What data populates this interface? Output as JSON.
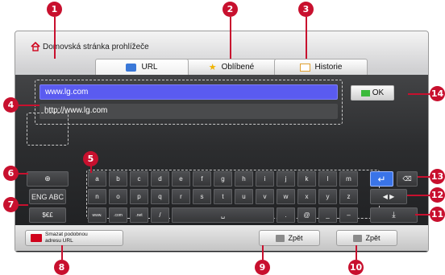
{
  "header": {
    "title": "Domovská stránka prohlížeče"
  },
  "tabs": [
    {
      "label": "URL"
    },
    {
      "label": "Oblíbené"
    },
    {
      "label": "Historie"
    }
  ],
  "url_panel": {
    "rows": [
      "www.lg.com",
      "http://www.lg.com"
    ]
  },
  "ok_label": "OK",
  "keyboard": {
    "row1": [
      "a",
      "b",
      "c",
      "d",
      "e",
      "f",
      "g",
      "h",
      "i",
      "j",
      "k",
      "l",
      "m"
    ],
    "row2": [
      "n",
      "o",
      "p",
      "q",
      "r",
      "s",
      "t",
      "u",
      "v",
      "w",
      "x",
      "y",
      "z"
    ],
    "row3": [
      "www.",
      ".com",
      ".net",
      "/",
      "␣",
      ".",
      "@",
      "_",
      "–"
    ]
  },
  "side_keys": {
    "globe": "⊕",
    "lang": "ENG ABC",
    "symbols": "$€£",
    "enter": "↵",
    "backspace": "⌫",
    "arrows": "◀ ▶",
    "download": "⤓"
  },
  "bottom": {
    "clear_label": "Smazat podobnou adresu URL",
    "back1_label": "Zpět",
    "back2_label": "Zpět"
  },
  "callouts": [
    "1",
    "2",
    "3",
    "4",
    "5",
    "6",
    "7",
    "8",
    "9",
    "10",
    "11",
    "12",
    "13",
    "14"
  ],
  "colors": {
    "accent": "#c8102e",
    "selected_row": "#5a5bf0",
    "enter": "#3a74e8"
  }
}
